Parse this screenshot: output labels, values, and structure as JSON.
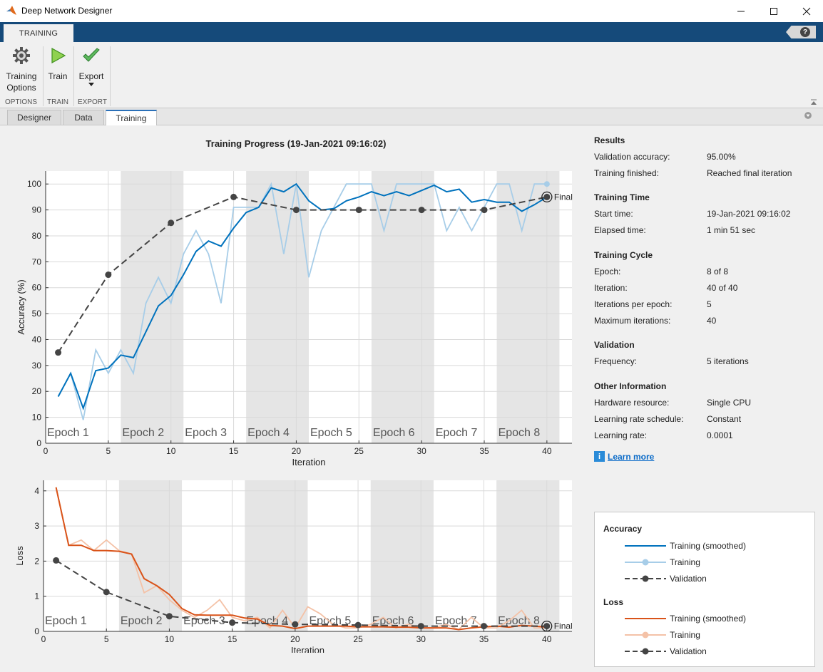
{
  "window": {
    "title": "Deep Network Designer"
  },
  "ribbon": {
    "tab": "TRAINING",
    "help": "?"
  },
  "toolstrip": {
    "training_options": "Training\nOptions",
    "train": "Train",
    "export": "Export",
    "sections": {
      "options": "OPTIONS",
      "train": "TRAIN",
      "export": "EXPORT"
    }
  },
  "tabs": [
    "Designer",
    "Data",
    "Training"
  ],
  "plot": {
    "title": "Training Progress (19-Jan-2021 09:16:02)"
  },
  "chart_data": [
    {
      "type": "line",
      "ylabel": "Accuracy (%)",
      "xlabel": "Iteration",
      "xlim": [
        0,
        42
      ],
      "ylim": [
        0,
        105
      ],
      "xticks": [
        0,
        5,
        10,
        15,
        20,
        25,
        30,
        35,
        40
      ],
      "yticks": [
        0,
        10,
        20,
        30,
        40,
        50,
        60,
        70,
        80,
        90,
        100
      ],
      "epoch_labels": [
        "Epoch 1",
        "Epoch 2",
        "Epoch 3",
        "Epoch 4",
        "Epoch 5",
        "Epoch 6",
        "Epoch 7",
        "Epoch 8"
      ],
      "final_label": "Final",
      "grid": true,
      "series": [
        {
          "name": "Training (smoothed)",
          "color": "#0072bd",
          "x": [
            1,
            2,
            3,
            4,
            5,
            6,
            7,
            8,
            9,
            10,
            11,
            12,
            13,
            14,
            15,
            16,
            17,
            18,
            19,
            20,
            21,
            22,
            23,
            24,
            25,
            26,
            27,
            28,
            29,
            30,
            31,
            32,
            33,
            34,
            35,
            36,
            37,
            38,
            39,
            40
          ],
          "y": [
            18,
            27,
            13.5,
            28,
            29,
            34,
            33,
            43,
            53,
            57,
            65,
            74,
            78,
            76,
            83,
            89,
            91,
            98.5,
            97,
            100,
            93.5,
            90,
            90.5,
            93.5,
            95,
            97,
            95.5,
            97,
            95.5,
            97.5,
            99.5,
            97,
            98,
            93,
            94,
            93,
            93,
            89.5,
            92,
            95
          ]
        },
        {
          "name": "Training",
          "color": "#a7cde8",
          "x": [
            1,
            2,
            3,
            4,
            5,
            6,
            7,
            8,
            9,
            10,
            11,
            12,
            13,
            14,
            15,
            16,
            17,
            18,
            19,
            20,
            21,
            22,
            23,
            24,
            25,
            26,
            27,
            28,
            29,
            30,
            31,
            32,
            33,
            34,
            35,
            36,
            37,
            38,
            39,
            40
          ],
          "y": [
            18,
            27,
            9,
            36,
            27,
            36,
            27,
            54,
            64,
            54,
            73,
            82,
            73,
            54,
            91,
            91,
            91,
            100,
            73,
            100,
            64,
            82,
            91,
            100,
            100,
            100,
            82,
            100,
            100,
            100,
            100,
            82,
            91,
            82,
            91,
            100,
            100,
            82,
            100,
            100
          ]
        },
        {
          "name": "Validation",
          "color": "#444444",
          "x": [
            1,
            5,
            10,
            15,
            20,
            25,
            30,
            35,
            40
          ],
          "y": [
            35,
            65,
            85,
            95,
            90,
            90,
            90,
            90,
            95
          ]
        }
      ]
    },
    {
      "type": "line",
      "ylabel": "Loss",
      "xlabel": "Iteration",
      "xlim": [
        0,
        42
      ],
      "ylim": [
        0,
        4.3
      ],
      "xticks": [
        0,
        5,
        10,
        15,
        20,
        25,
        30,
        35,
        40
      ],
      "yticks": [
        0,
        1,
        2,
        3,
        4
      ],
      "epoch_labels": [
        "Epoch 1",
        "Epoch 2",
        "Epoch 3",
        "Epoch 4",
        "Epoch 5",
        "Epoch 6",
        "Epoch 7",
        "Epoch 8"
      ],
      "final_label": "Final",
      "grid": true,
      "series": [
        {
          "name": "Training (smoothed)",
          "color": "#d95319",
          "x": [
            1,
            2,
            3,
            4,
            5,
            6,
            7,
            8,
            9,
            10,
            11,
            12,
            13,
            14,
            15,
            16,
            17,
            18,
            19,
            20,
            21,
            22,
            23,
            24,
            25,
            26,
            27,
            28,
            29,
            30,
            31,
            32,
            33,
            34,
            35,
            36,
            37,
            38,
            39,
            40
          ],
          "y": [
            4.1,
            2.45,
            2.45,
            2.3,
            2.3,
            2.28,
            2.2,
            1.5,
            1.3,
            1.05,
            0.65,
            0.47,
            0.46,
            0.46,
            0.46,
            0.38,
            0.35,
            0.17,
            0.15,
            0.08,
            0.15,
            0.15,
            0.15,
            0.15,
            0.13,
            0.13,
            0.13,
            0.12,
            0.12,
            0.1,
            0.1,
            0.1,
            0.05,
            0.1,
            0.13,
            0.15,
            0.12,
            0.17,
            0.15,
            0.12
          ]
        },
        {
          "name": "Training",
          "color": "#f4c2a7",
          "x": [
            1,
            2,
            3,
            4,
            5,
            6,
            7,
            8,
            9,
            10,
            11,
            12,
            13,
            14,
            15,
            16,
            17,
            18,
            19,
            20,
            21,
            22,
            23,
            24,
            25,
            26,
            27,
            28,
            29,
            30,
            31,
            32,
            33,
            34,
            35,
            36,
            37,
            38,
            39,
            40
          ],
          "y": [
            4.1,
            2.45,
            2.6,
            2.3,
            2.6,
            2.3,
            2.2,
            1.1,
            1.3,
            0.9,
            0.6,
            0.4,
            0.6,
            0.9,
            0.4,
            0.3,
            0.4,
            0.1,
            0.6,
            0.1,
            0.7,
            0.5,
            0.2,
            0.1,
            0.1,
            0.2,
            0.4,
            0.1,
            0.2,
            0.1,
            0.1,
            0.2,
            0.05,
            0.4,
            0.1,
            0.1,
            0.3,
            0.6,
            0.1,
            0.1
          ]
        },
        {
          "name": "Validation",
          "color": "#444444",
          "x": [
            1,
            5,
            10,
            15,
            20,
            25,
            30,
            35,
            40
          ],
          "y": [
            2.02,
            1.12,
            0.43,
            0.25,
            0.2,
            0.18,
            0.15,
            0.15,
            0.15
          ]
        }
      ]
    }
  ],
  "results": {
    "results_h": "Results",
    "val_acc_k": "Validation accuracy:",
    "val_acc_v": "95.00%",
    "finished_k": "Training finished:",
    "finished_v": "Reached final iteration",
    "time_h": "Training Time",
    "start_k": "Start time:",
    "start_v": "19-Jan-2021 09:16:02",
    "elapsed_k": "Elapsed time:",
    "elapsed_v": "1 min 51 sec",
    "cycle_h": "Training Cycle",
    "epoch_k": "Epoch:",
    "epoch_v": "8 of 8",
    "iter_k": "Iteration:",
    "iter_v": "40 of 40",
    "ipe_k": "Iterations per epoch:",
    "ipe_v": "5",
    "maxit_k": "Maximum iterations:",
    "maxit_v": "40",
    "val_h": "Validation",
    "freq_k": "Frequency:",
    "freq_v": "5 iterations",
    "other_h": "Other Information",
    "hw_k": "Hardware resource:",
    "hw_v": "Single CPU",
    "lrs_k": "Learning rate schedule:",
    "lrs_v": "Constant",
    "lr_k": "Learning rate:",
    "lr_v": "0.0001",
    "learn_more": "Learn more"
  },
  "legend": {
    "acc_h": "Accuracy",
    "loss_h": "Loss",
    "smoothed": "Training (smoothed)",
    "training": "Training",
    "validation": "Validation"
  }
}
